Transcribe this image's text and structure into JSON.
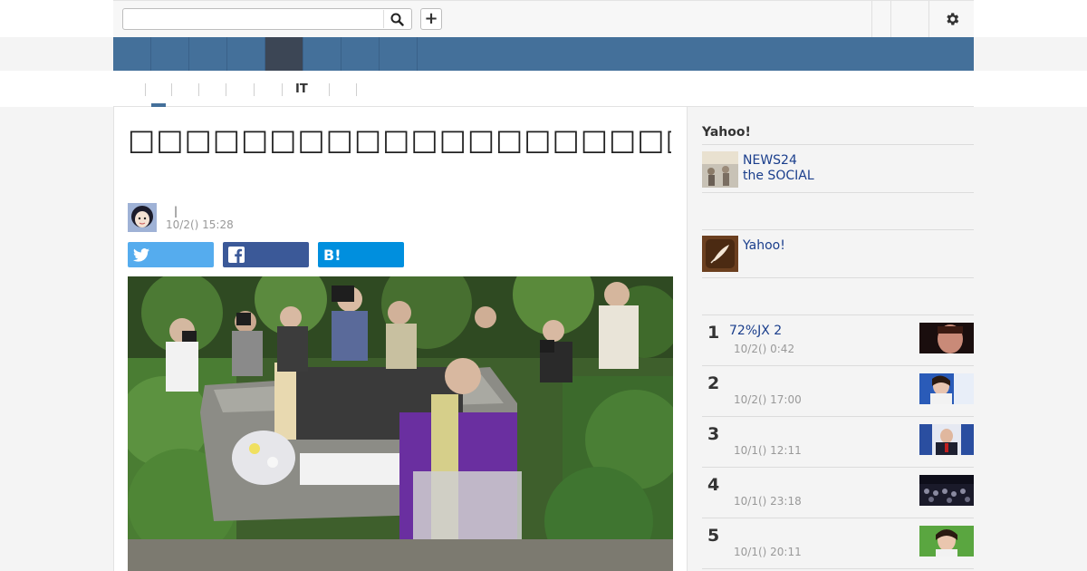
{
  "header": {
    "search": {
      "value": "",
      "placeholder": ""
    },
    "add_label": "+"
  },
  "navbar": {
    "tabs": [
      {
        "label": ""
      },
      {
        "label": ""
      },
      {
        "label": ""
      },
      {
        "label": ""
      },
      {
        "label": "",
        "active": true
      },
      {
        "label": ""
      },
      {
        "label": ""
      },
      {
        "label": ""
      }
    ]
  },
  "subnav": {
    "items": [
      {
        "label": ""
      },
      {
        "label": ""
      },
      {
        "label": ""
      },
      {
        "label": ""
      },
      {
        "label": ""
      },
      {
        "label": "IT"
      },
      {
        "label": ""
      }
    ]
  },
  "article": {
    "title": "□□□□□□□□□□□□□□□□□□□□□□□□□□□□□□□□□",
    "author_line": "|",
    "datetime": "10/2() 15:28",
    "share": {
      "twitter": "",
      "facebook": "",
      "hatena": "B!"
    }
  },
  "sidebar": {
    "title": "Yahoo!",
    "promo1": {
      "line1": "NEWS24",
      "line2": "the SOCIAL"
    },
    "promo2": {
      "label": "Yahoo!"
    },
    "ranking": [
      {
        "rank": "1",
        "title": "72%JX 2",
        "time": "10/2() 0:42"
      },
      {
        "rank": "2",
        "title": "",
        "time": "10/2() 17:00"
      },
      {
        "rank": "3",
        "title": "",
        "time": "10/1() 12:11"
      },
      {
        "rank": "4",
        "title": "",
        "time": "10/1() 23:18"
      },
      {
        "rank": "5",
        "title": "",
        "time": "10/1() 20:11"
      }
    ]
  },
  "colors": {
    "nav_bg": "#44709a",
    "nav_active": "#3c4655",
    "twitter": "#55acee",
    "facebook": "#3b5998",
    "hatena": "#008fde",
    "link": "#1a3e8c"
  }
}
